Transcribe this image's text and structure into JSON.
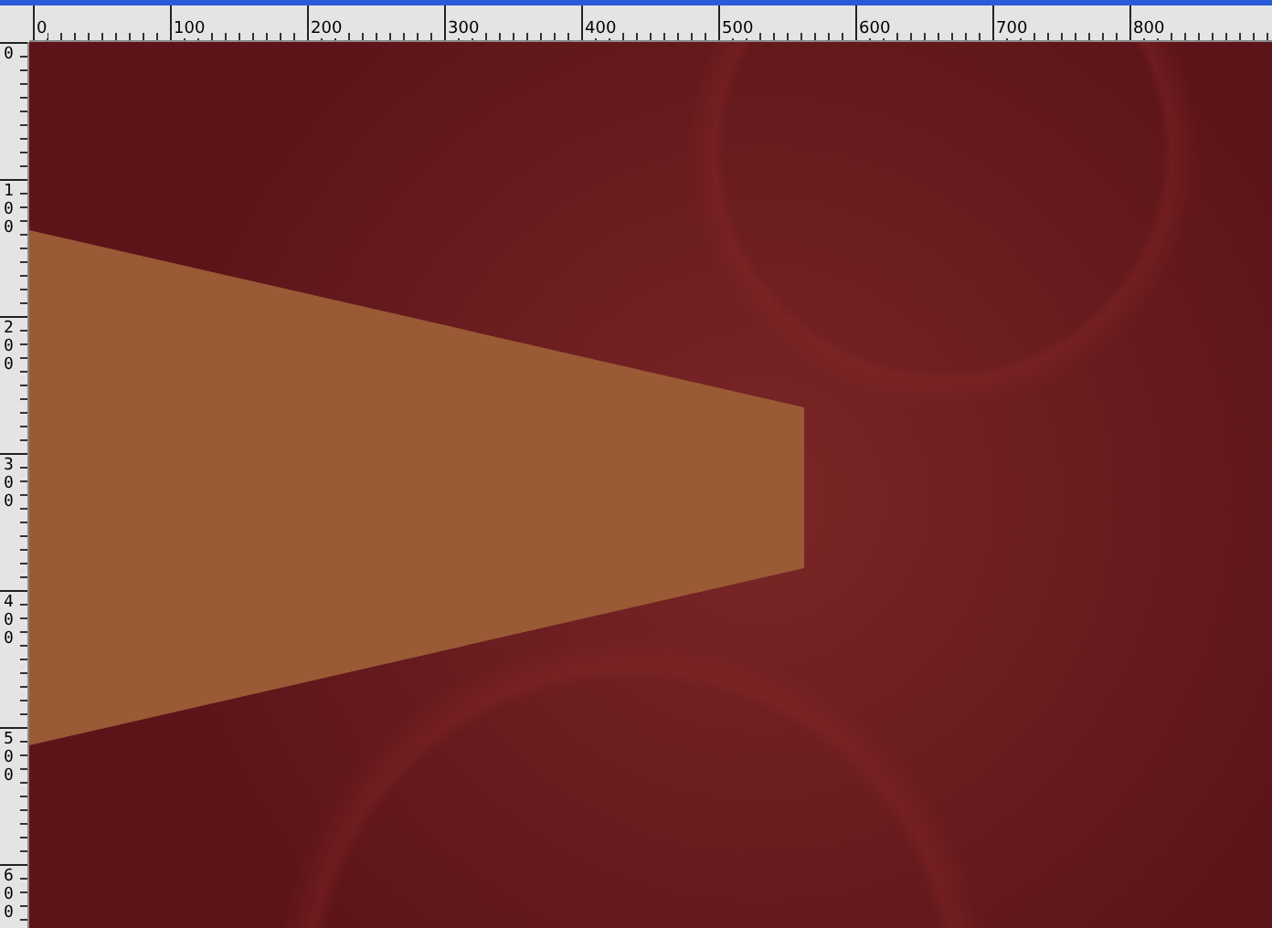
{
  "rulers": {
    "horizontal": [
      "0",
      "100",
      "200",
      "300",
      "400",
      "500",
      "600",
      "700",
      "800"
    ],
    "vertical": [
      "0",
      "100",
      "200",
      "300",
      "400",
      "500",
      "600"
    ]
  },
  "canvas": {
    "shapes": [
      {
        "kind": "trapezoid",
        "color": "#995a35"
      }
    ]
  }
}
